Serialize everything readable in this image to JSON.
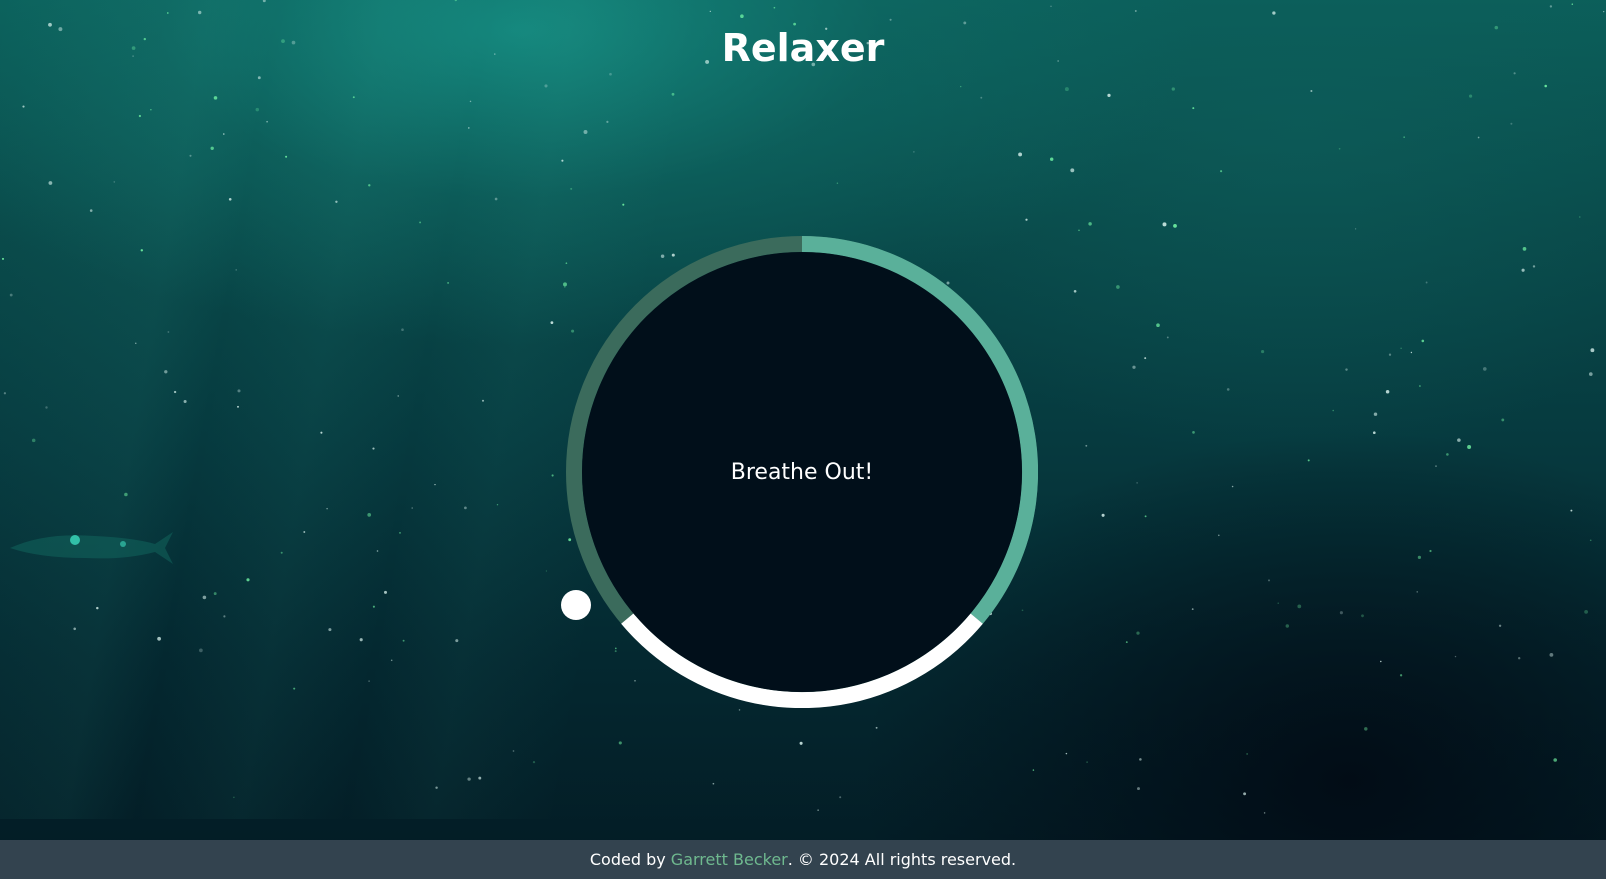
{
  "app": {
    "title": "Relaxer"
  },
  "breathing": {
    "instruction": "Breathe Out!"
  },
  "footer": {
    "prefix": "Coded by ",
    "author_link": "Garrett Becker",
    "suffix": ". © 2024 All rights reserved."
  },
  "colors": {
    "ring_dark": "#3b6b5c",
    "ring_teal": "#5ab09a",
    "ring_white": "#ffffff",
    "inner_circle": "#010f1a",
    "footer_bg": "#33434f",
    "link": "#6fb98f"
  },
  "icons": {
    "pointer": "white-dot-pointer-icon",
    "fish": "fish-silhouette-icon"
  }
}
